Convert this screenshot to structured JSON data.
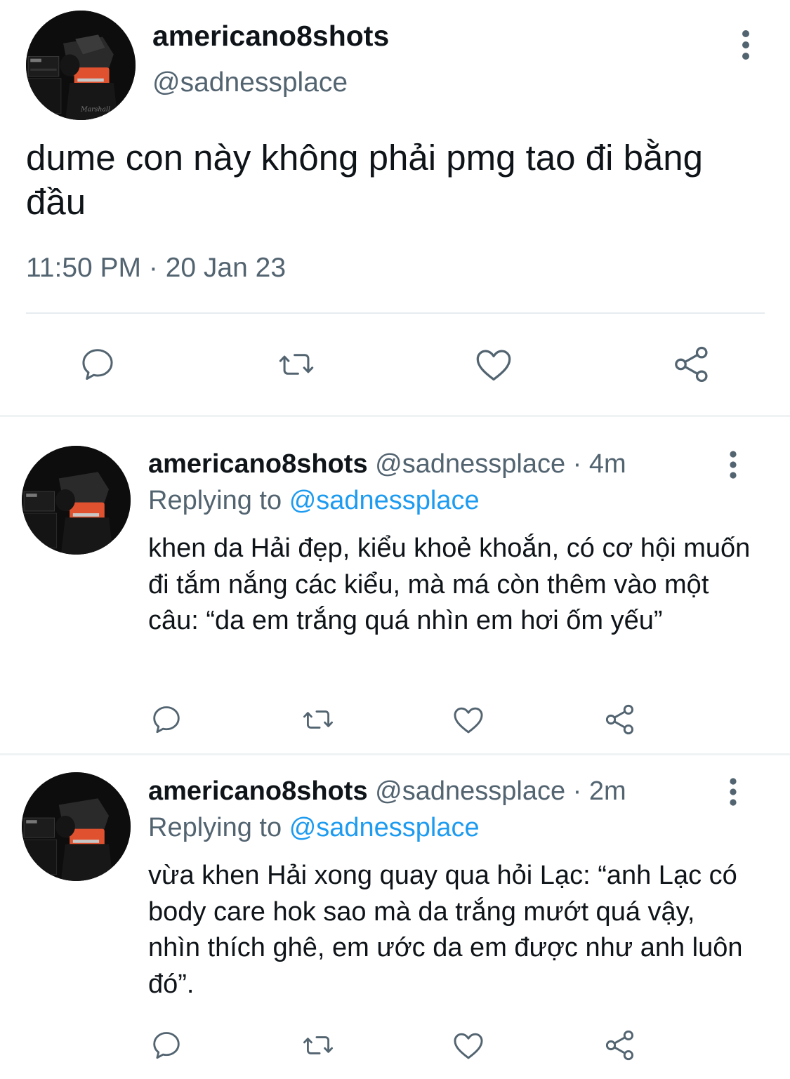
{
  "main_tweet": {
    "display_name": "americano8shots",
    "handle": "@sadnessplace",
    "text": "dume con này không phải pmg tao đi bằng đầu",
    "timestamp": "11:50 PM · 20 Jan 23",
    "actions": [
      "reply-icon",
      "retweet-icon",
      "like-icon",
      "share-icon"
    ]
  },
  "replies": [
    {
      "display_name": "americano8shots",
      "handle": "@sadnessplace",
      "separator": "·",
      "age": "4m",
      "replying_label": "Replying to",
      "replying_to": "@sadnessplace",
      "text": "khen da Hải đẹp, kiểu khoẻ khoắn, có cơ hội muốn đi tắm nắng các kiểu, mà má còn thêm vào một câu: “da em trắng quá nhìn em hơi ốm yếu”"
    },
    {
      "display_name": "americano8shots",
      "handle": "@sadnessplace",
      "separator": "·",
      "age": "2m",
      "replying_label": "Replying to",
      "replying_to": "@sadnessplace",
      "text": "vừa khen Hải xong quay qua hỏi Lạc: “anh Lạc có body care hok sao mà da trắng mướt quá vậy, nhìn thích ghê, em ước da em được như anh luôn đó”."
    }
  ],
  "colors": {
    "text": "#0f1419",
    "secondary": "#536471",
    "link": "#1d9bf0",
    "divider": "#eff3f4"
  }
}
